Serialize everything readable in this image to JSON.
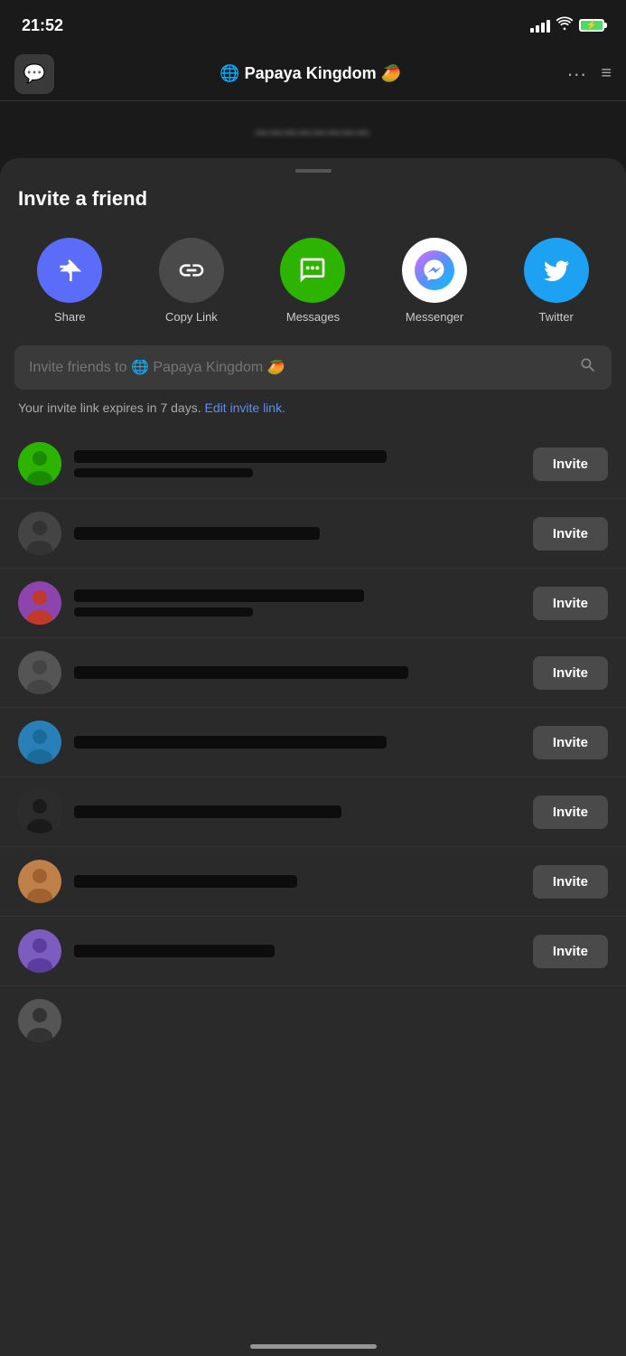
{
  "statusBar": {
    "time": "21:52"
  },
  "appBar": {
    "chatIcon": "💬",
    "title": "🌐 Papaya Kingdom 🥭",
    "moreIcon": "···",
    "menuIcon": "≡"
  },
  "invitePanel": {
    "title": "Invite a friend",
    "shareItems": [
      {
        "id": "share",
        "label": "Share",
        "colorClass": "circle-blue"
      },
      {
        "id": "copy-link",
        "label": "Copy Link",
        "colorClass": "circle-gray"
      },
      {
        "id": "messages",
        "label": "Messages",
        "colorClass": "circle-green"
      },
      {
        "id": "messenger",
        "label": "Messenger",
        "colorClass": "circle-white"
      },
      {
        "id": "twitter",
        "label": "Twitter",
        "colorClass": "circle-twitter"
      }
    ],
    "searchPlaceholder": "Invite friends to 🌐 Papaya Kingdom 🥭",
    "expireText": "Your invite link expires in 7 days.",
    "editLinkText": "Edit invite link.",
    "inviteButtonLabel": "Invite",
    "friends": [
      {
        "id": 1,
        "avatarClass": "av-green"
      },
      {
        "id": 2,
        "avatarClass": "av-dark"
      },
      {
        "id": 3,
        "avatarClass": "av-multi"
      },
      {
        "id": 4,
        "avatarClass": "av-gray"
      },
      {
        "id": 5,
        "avatarClass": "av-dark2"
      },
      {
        "id": 6,
        "avatarClass": "av-dark"
      },
      {
        "id": 7,
        "avatarClass": "av-warm"
      },
      {
        "id": 8,
        "avatarClass": "av-purple"
      },
      {
        "id": 9,
        "avatarClass": "av-gray"
      }
    ]
  }
}
